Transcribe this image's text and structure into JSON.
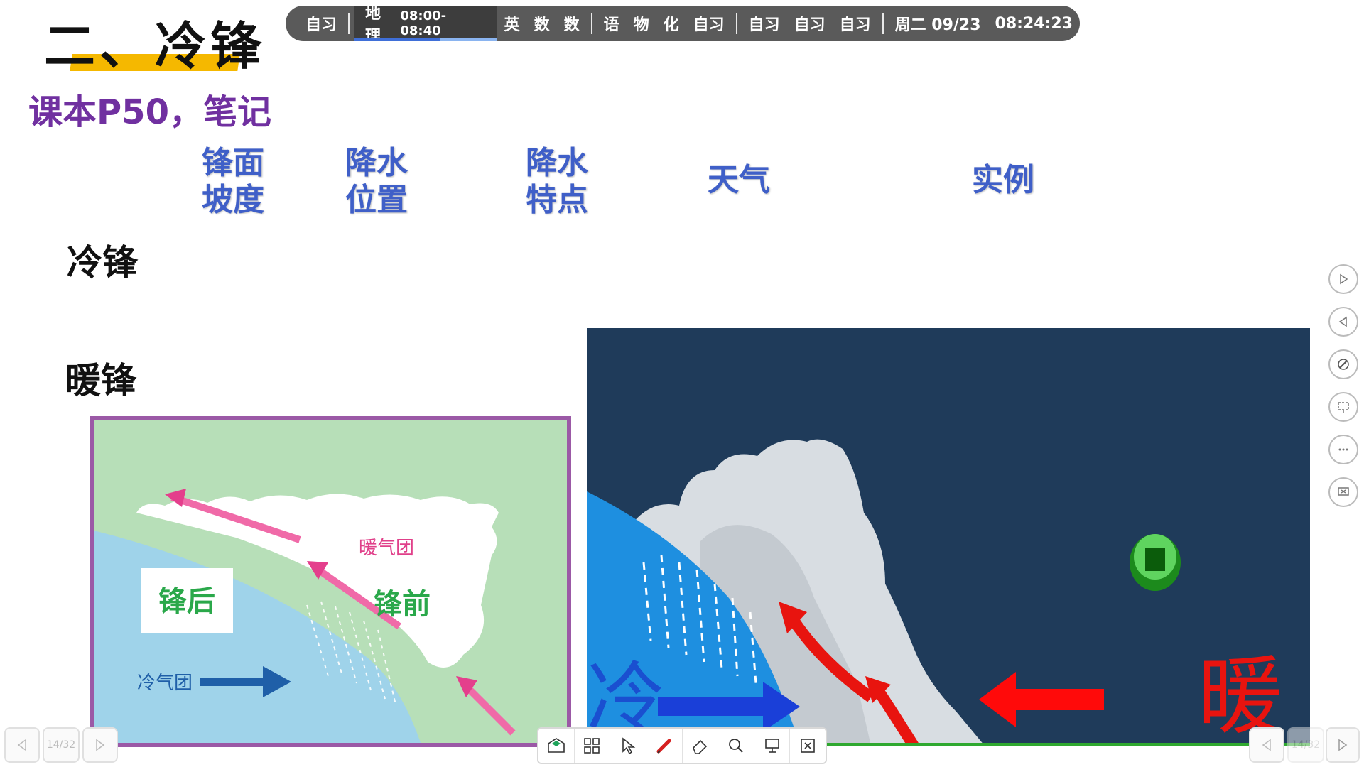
{
  "title": "二、冷锋",
  "subtitle": "课本P50，笔记",
  "schedule": {
    "before": [
      "自习"
    ],
    "active": {
      "label": "地理",
      "time": "08:00-08:40"
    },
    "group1": [
      "英",
      "数",
      "数"
    ],
    "group2": [
      "语",
      "物",
      "化",
      "自习"
    ],
    "group3": [
      "自习",
      "自习",
      "自习"
    ],
    "date": "周二 09/23",
    "clock": "08:24:23"
  },
  "columns": {
    "c1": [
      "锋面",
      "坡度"
    ],
    "c2": [
      "降水",
      "位置"
    ],
    "c3": [
      "降水",
      "特点"
    ],
    "c4": "天气",
    "c5": "实例"
  },
  "rows": {
    "cold": "冷锋",
    "warm": "暖锋"
  },
  "left_diagram": {
    "warm_air_mass": "暖气团",
    "cold_air_mass": "冷气团",
    "behind_front": "锋后",
    "front_of_front": "锋前"
  },
  "right_diagram": {
    "cold": "冷",
    "warm": "暖"
  },
  "right_tools": [
    "play-forward-icon",
    "play-back-icon",
    "pen-icon",
    "screen-select-icon",
    "more-icon",
    "exit-screen-icon"
  ],
  "toolbar_icons": [
    "open-board-icon",
    "apps-grid-icon",
    "cursor-icon",
    "pen-tool-icon",
    "eraser-icon",
    "magnifier-icon",
    "presenter-icon",
    "close-slide-icon"
  ],
  "pager": {
    "left": "14/32",
    "right": "14/32"
  },
  "colors": {
    "accent_title_bar": "#f5b800",
    "subtitle": "#7030a0",
    "column_heading": "#3f5fc8",
    "schedule_bar": "#5a5a5a"
  }
}
